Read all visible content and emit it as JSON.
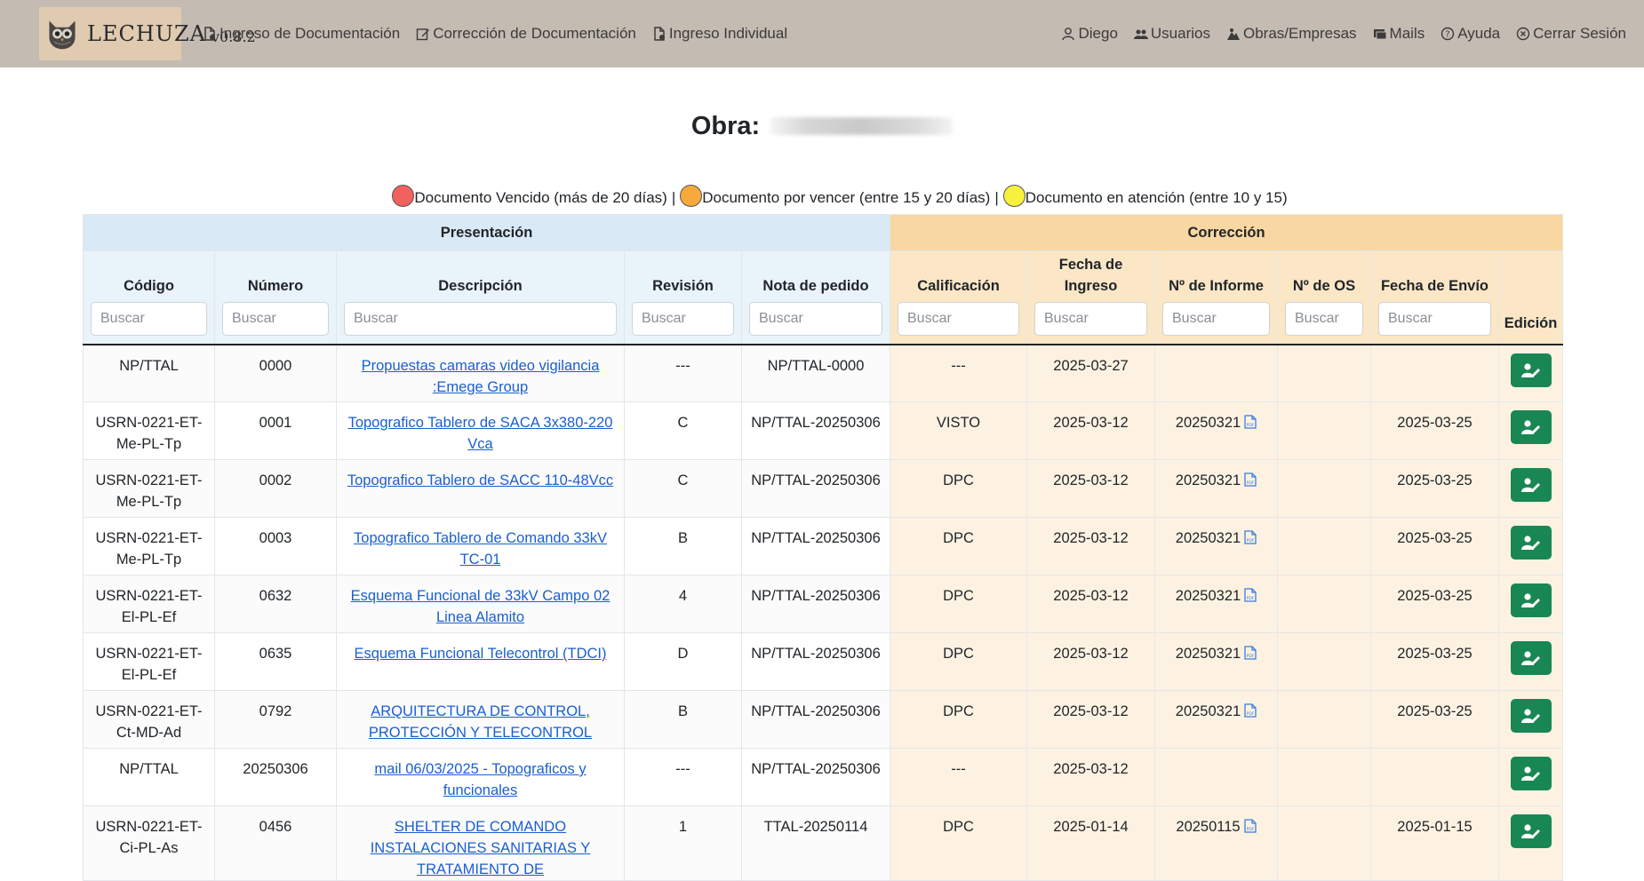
{
  "brand": {
    "name": "LECHUZA",
    "version": "v0.8.2"
  },
  "nav": {
    "left": [
      {
        "label": "Ingreso de Documentación",
        "icon": "file-upload-icon"
      },
      {
        "label": "Corrección de Documentación",
        "icon": "edit-document-icon"
      },
      {
        "label": "Ingreso Individual",
        "icon": "file-upload-icon"
      }
    ],
    "right": [
      {
        "label": "Diego",
        "icon": "user-icon"
      },
      {
        "label": "Usuarios",
        "icon": "users-icon"
      },
      {
        "label": "Obras/Empresas",
        "icon": "building-icon"
      },
      {
        "label": "Mails",
        "icon": "mail-icon"
      },
      {
        "label": "Ayuda",
        "icon": "help-icon"
      },
      {
        "label": "Cerrar Sesión",
        "icon": "close-circle-icon"
      }
    ]
  },
  "title": {
    "label": "Obra:"
  },
  "legend": {
    "vencido": "Documento Vencido (más de 20 días)",
    "por_vencer": "Documento por vencer (entre 15 y 20 días)",
    "atencion": "Documento en atención (entre 10 y 15)",
    "separator": "|",
    "colors": {
      "red": "#f2615e",
      "orange": "#f8a93c",
      "yellow": "#f7f13c"
    }
  },
  "table": {
    "groups": {
      "presentacion": "Presentación",
      "correccion": "Corrección"
    },
    "columns": {
      "codigo": "Código",
      "numero": "Número",
      "descripcion": "Descripción",
      "revision": "Revisión",
      "nota": "Nota de pedido",
      "calificacion": "Calificación",
      "fecha_ingreso": "Fecha de Ingreso",
      "informe": "Nº de Informe",
      "os": "Nº de OS",
      "fecha_envio": "Fecha de Envío",
      "edicion": "Edición"
    },
    "search_placeholder": "Buscar",
    "rows": [
      {
        "codigo": "NP/TTAL",
        "numero": "0000",
        "descripcion": "Propuestas camaras video vigilancia :Emege Group",
        "revision": "---",
        "nota": "NP/TTAL-0000",
        "calificacion": "---",
        "fecha_ingreso": "2025-03-27",
        "informe": "",
        "os": "",
        "fecha_envio": ""
      },
      {
        "codigo": "USRN-0221-ET-Me-PL-Tp",
        "numero": "0001",
        "descripcion": "Topografico Tablero de SACA 3x380-220 Vca",
        "revision": "C",
        "nota": "NP/TTAL-20250306",
        "calificacion": "VISTO",
        "fecha_ingreso": "2025-03-12",
        "informe": "20250321",
        "os": "",
        "fecha_envio": "2025-03-25"
      },
      {
        "codigo": "USRN-0221-ET-Me-PL-Tp",
        "numero": "0002",
        "descripcion": "Topografico Tablero de SACC 110-48Vcc",
        "revision": "C",
        "nota": "NP/TTAL-20250306",
        "calificacion": "DPC",
        "fecha_ingreso": "2025-03-12",
        "informe": "20250321",
        "os": "",
        "fecha_envio": "2025-03-25"
      },
      {
        "codigo": "USRN-0221-ET-Me-PL-Tp",
        "numero": "0003",
        "descripcion": "Topografico Tablero de Comando 33kV TC-01",
        "revision": "B",
        "nota": "NP/TTAL-20250306",
        "calificacion": "DPC",
        "fecha_ingreso": "2025-03-12",
        "informe": "20250321",
        "os": "",
        "fecha_envio": "2025-03-25"
      },
      {
        "codigo": "USRN-0221-ET-El-PL-Ef",
        "numero": "0632",
        "descripcion": "Esquema Funcional de 33kV Campo 02 Linea Alamito",
        "revision": "4",
        "nota": "NP/TTAL-20250306",
        "calificacion": "DPC",
        "fecha_ingreso": "2025-03-12",
        "informe": "20250321",
        "os": "",
        "fecha_envio": "2025-03-25"
      },
      {
        "codigo": "USRN-0221-ET-El-PL-Ef",
        "numero": "0635",
        "descripcion": "Esquema Funcional Telecontrol (TDCI)",
        "revision": "D",
        "nota": "NP/TTAL-20250306",
        "calificacion": "DPC",
        "fecha_ingreso": "2025-03-12",
        "informe": "20250321",
        "os": "",
        "fecha_envio": "2025-03-25"
      },
      {
        "codigo": "USRN-0221-ET-Ct-MD-Ad",
        "numero": "0792",
        "descripcion": "ARQUITECTURA DE CONTROL, PROTECCIÓN Y TELECONTROL",
        "revision": "B",
        "nota": "NP/TTAL-20250306",
        "calificacion": "DPC",
        "fecha_ingreso": "2025-03-12",
        "informe": "20250321",
        "os": "",
        "fecha_envio": "2025-03-25"
      },
      {
        "codigo": "NP/TTAL",
        "numero": "20250306",
        "descripcion": "mail 06/03/2025 - Topograficos y funcionales",
        "revision": "---",
        "nota": "NP/TTAL-20250306",
        "calificacion": "---",
        "fecha_ingreso": "2025-03-12",
        "informe": "",
        "os": "",
        "fecha_envio": ""
      },
      {
        "codigo": "USRN-0221-ET-Ci-PL-As",
        "numero": "0456",
        "descripcion": "SHELTER DE COMANDO INSTALACIONES SANITARIAS Y TRATAMIENTO DE",
        "revision": "1",
        "nota": "TTAL-20250114",
        "calificacion": "DPC",
        "fecha_ingreso": "2025-01-14",
        "informe": "20250115",
        "os": "",
        "fecha_envio": "2025-01-15"
      }
    ]
  }
}
